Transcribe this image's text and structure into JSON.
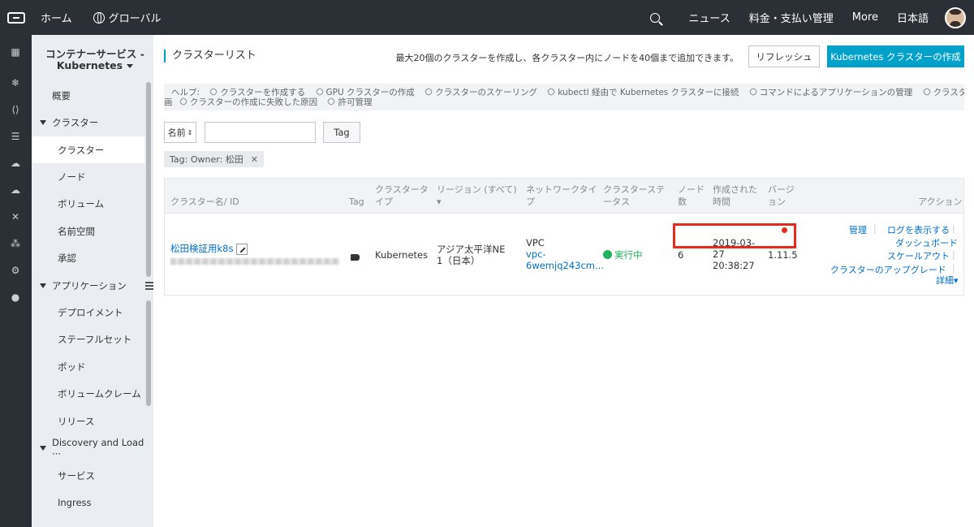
{
  "topbar": {
    "home": "ホーム",
    "global": "グローバル",
    "news": "ニュース",
    "billing": "料金・支払い管理",
    "more": "More",
    "language": "日本語"
  },
  "sidebar": {
    "title_line1": "コンテナーサービス -",
    "title_line2": "Kubernetes",
    "items": [
      {
        "label": "概要"
      },
      {
        "label": "クラスター"
      },
      {
        "label": "クラスター"
      },
      {
        "label": "ノード"
      },
      {
        "label": "ボリューム"
      },
      {
        "label": "名前空間"
      },
      {
        "label": "承認"
      },
      {
        "label": "アプリケーション"
      },
      {
        "label": "デプロイメント"
      },
      {
        "label": "ステーフルセット"
      },
      {
        "label": "ポッド"
      },
      {
        "label": "ボリュームクレーム"
      },
      {
        "label": "リリース"
      },
      {
        "label": "Discovery and Load ···"
      },
      {
        "label": "サービス"
      },
      {
        "label": "Ingress"
      }
    ]
  },
  "main": {
    "page_title": "クラスターリスト",
    "limit_note": "最大20個のクラスターを作成し、各クラスター内にノードを40個まで追加できます。",
    "refresh_button": "リフレッシュ",
    "create_button": "Kubernetes クラスターの作成",
    "help": {
      "label": "ヘルプ:",
      "links": [
        "クラスターを作成する",
        "GPU クラスターの作成",
        "クラスターのスケーリング",
        "kubectl 経由で Kubernetes クラスターに接続",
        "コマンドによるアプリケーションの管理",
        "クラスター計"
      ],
      "line2_prefix": "画",
      "links2": [
        "クラスターの作成に失敗した原因",
        "許可管理"
      ]
    },
    "filter": {
      "select_value": "名前",
      "input_value": "",
      "tag_button": "Tag",
      "tag_chip": "Tag: Owner: 松田"
    },
    "table": {
      "headers": {
        "name": "クラスター名/ ID",
        "tag": "Tag",
        "type_l1": "クラスタータ",
        "type_l2": "イプ",
        "region_l1": "リージョン (すべて)",
        "network_l1": "ネットワークタイ",
        "network_l2": "プ",
        "status_l1": "クラスターステ",
        "status_l2": "ータス",
        "nodes_l1": "ノード",
        "nodes_l2": "数",
        "created_l1": "作成された",
        "created_l2": "時間",
        "version_l1": "バージ",
        "version_l2": "ョン",
        "actions": "アクション"
      },
      "rows": [
        {
          "name": "松田検証用k8s",
          "type": "Kubernetes",
          "region_l1": "アジア太平洋NE",
          "region_l2": "1（日本）",
          "network_l1": "VPC",
          "network_l2": "vpc-",
          "network_l3": "6wemjq243cm...",
          "status": "実行中",
          "nodes": "6",
          "created_l1": "2019-03-",
          "created_l2": "27",
          "created_l3": "20:38:27",
          "version": "1.11.5",
          "actions": {
            "manage": "管理",
            "logs": "ログを表示する",
            "dashboard": "ダッシュボード",
            "scaleout": "スケールアウト",
            "upgrade": "クラスターのアップグレード",
            "details": "詳細"
          }
        }
      ]
    }
  }
}
